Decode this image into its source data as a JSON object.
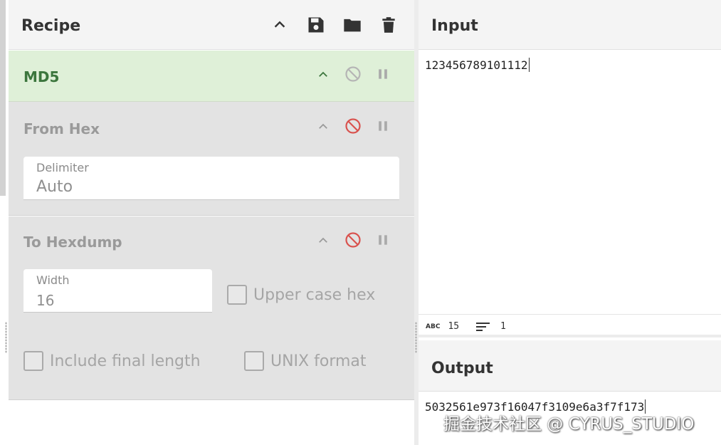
{
  "recipe": {
    "title": "Recipe",
    "header_icons": [
      "chevron-up-icon",
      "save-icon",
      "folder-icon",
      "trash-icon"
    ],
    "operations": [
      {
        "name": "MD5",
        "state": "enabled",
        "accent": "#3c763d",
        "background": "#dff0d8"
      },
      {
        "name": "From Hex",
        "state": "disabled",
        "accent": "#9a9a9a",
        "background": "#e3e3e3",
        "args": {
          "delimiter_label": "Delimiter",
          "delimiter_value": "Auto"
        }
      },
      {
        "name": "To Hexdump",
        "state": "disabled",
        "accent": "#9a9a9a",
        "background": "#e3e3e3",
        "args": {
          "width_label": "Width",
          "width_value": "16",
          "upper_case_hex": "Upper case hex",
          "include_final_length": "Include final length",
          "unix_format": "UNIX format"
        }
      }
    ],
    "disabled_icon_color": "#d9534f"
  },
  "input": {
    "title": "Input",
    "value": "123456789101112"
  },
  "status": {
    "length_icon": "abc-icon",
    "length": "15",
    "lines_icon": "lines-icon",
    "lines": "1"
  },
  "output": {
    "title": "Output",
    "value": "5032561e973f16047f3109e6a3f7f173"
  },
  "watermark": "掘金技术社区 @ CYRUS_STUDIO"
}
